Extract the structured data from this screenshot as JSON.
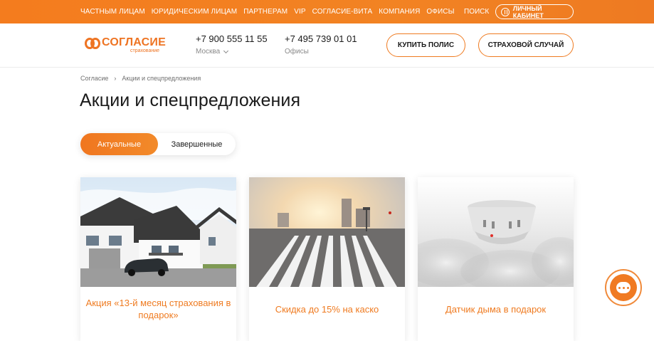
{
  "topnav": {
    "items": [
      "ЧАСТНЫМ ЛИЦАМ",
      "ЮРИДИЧЕСКИМ ЛИЦАМ",
      "ПАРТНЕРАМ",
      "VIP",
      "СОГЛАСИЕ-ВИТА",
      "КОМПАНИЯ",
      "ОФИСЫ"
    ],
    "search_label": "ПОИСК",
    "cabinet_label": "ЛИЧНЫЙ КАБИНЕТ"
  },
  "header": {
    "logo_name": "СОГЛАСИЕ",
    "logo_sub": "страхование",
    "phone1": "+7 900 555 11 55",
    "phone1_label": "Москва",
    "phone2": "+7 495 739 01 01",
    "phone2_label": "Офисы",
    "buy_label": "КУПИТЬ ПОЛИС",
    "claim_label": "СТРАХОВОЙ СЛУЧАЙ"
  },
  "breadcrumb": {
    "home": "Согласие",
    "current": "Акции и спецпредложения"
  },
  "page_title": "Акции и спецпредложения",
  "tabs": {
    "active": "Актуальные",
    "other": "Завершенные"
  },
  "cards": [
    {
      "title": "Акция «13-й месяц страхования в подарок»"
    },
    {
      "title": "Скидка до 15% на каско"
    },
    {
      "title": "Датчик дыма в подарок"
    }
  ],
  "colors": {
    "brand": "#ef7b21",
    "brand_light": "#f28a2a",
    "text": "#1a1a1a",
    "muted": "#8a8a8a"
  }
}
